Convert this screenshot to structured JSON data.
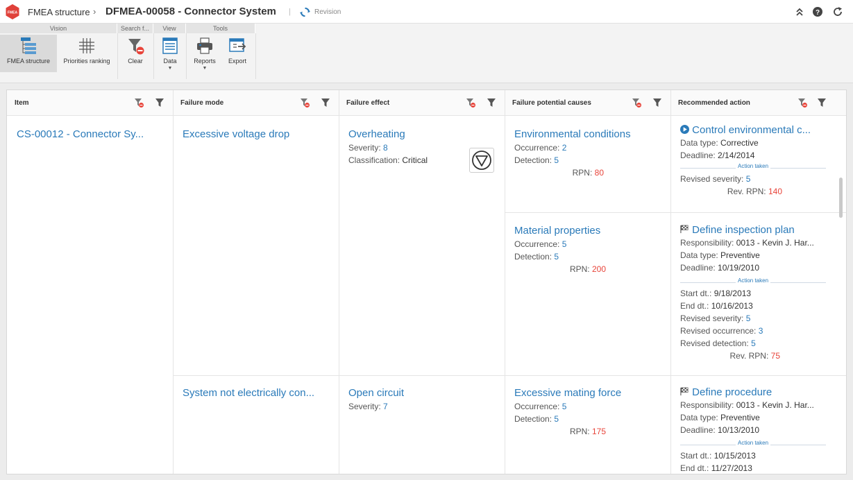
{
  "app": {
    "logo_text": "FMEA",
    "breadcrumb": "FMEA structure",
    "title": "DFMEA-00058 - Connector System",
    "revision_label": "Revision"
  },
  "ribbon": {
    "groups": [
      {
        "label": "Vision"
      },
      {
        "label": "Search f..."
      },
      {
        "label": "View"
      },
      {
        "label": "Tools"
      }
    ],
    "buttons": {
      "fmea_structure": "FMEA structure",
      "priorities_ranking": "Priorities ranking",
      "clear": "Clear",
      "data": "Data",
      "reports": "Reports",
      "export": "Export"
    }
  },
  "columns": {
    "item": "Item",
    "failure_mode": "Failure mode",
    "failure_effect": "Failure effect",
    "causes": "Failure potential causes",
    "action": "Recommended action"
  },
  "item": {
    "title": "CS-00012 - Connector Sy..."
  },
  "modes": [
    {
      "title": "Excessive voltage drop"
    },
    {
      "title": "System not electrically con..."
    }
  ],
  "effects": [
    {
      "title": "Overheating",
      "severity_label": "Severity:",
      "severity": "8",
      "class_label": "Classification:",
      "class_value": "Critical"
    },
    {
      "title": "Open circuit",
      "severity_label": "Severity:",
      "severity": "7"
    }
  ],
  "causes": [
    {
      "title": "Environmental conditions",
      "occ_label": "Occurrence:",
      "occ": "2",
      "det_label": "Detection:",
      "det": "5",
      "rpn_label": "RPN:",
      "rpn": "80"
    },
    {
      "title": "Material properties",
      "occ_label": "Occurrence:",
      "occ": "5",
      "det_label": "Detection:",
      "det": "5",
      "rpn_label": "RPN:",
      "rpn": "200"
    },
    {
      "title": "Excessive mating force",
      "occ_label": "Occurrence:",
      "occ": "5",
      "det_label": "Detection:",
      "det": "5",
      "rpn_label": "RPN:",
      "rpn": "175"
    }
  ],
  "actions": [
    {
      "title": "Control environmental c...",
      "icon": "play-circle-icon",
      "data_type_label": "Data type:",
      "data_type": "Corrective",
      "deadline_label": "Deadline:",
      "deadline": "2/14/2014",
      "taken_label": "Action taken",
      "rev_sev_label": "Revised severity:",
      "rev_sev": "5",
      "rev_rpn_label": "Rev. RPN:",
      "rev_rpn": "140"
    },
    {
      "title": "Define inspection plan",
      "icon": "checkered-flag-icon",
      "resp_label": "Responsibility:",
      "resp": "0013 - Kevin J. Har...",
      "data_type_label": "Data type:",
      "data_type": "Preventive",
      "deadline_label": "Deadline:",
      "deadline": "10/19/2010",
      "taken_label": "Action taken",
      "start_label": "Start dt.:",
      "start": "9/18/2013",
      "end_label": "End dt.:",
      "end": "10/16/2013",
      "rev_sev_label": "Revised severity:",
      "rev_sev": "5",
      "rev_occ_label": "Revised occurrence:",
      "rev_occ": "3",
      "rev_det_label": "Revised detection:",
      "rev_det": "5",
      "rev_rpn_label": "Rev. RPN:",
      "rev_rpn": "75"
    },
    {
      "title": "Define procedure",
      "icon": "checkered-flag-icon",
      "resp_label": "Responsibility:",
      "resp": "0013 - Kevin J. Har...",
      "data_type_label": "Data type:",
      "data_type": "Preventive",
      "deadline_label": "Deadline:",
      "deadline": "10/13/2010",
      "taken_label": "Action taken",
      "start_label": "Start dt.:",
      "start": "10/15/2013",
      "end_label": "End dt.:",
      "end": "11/27/2013"
    }
  ]
}
